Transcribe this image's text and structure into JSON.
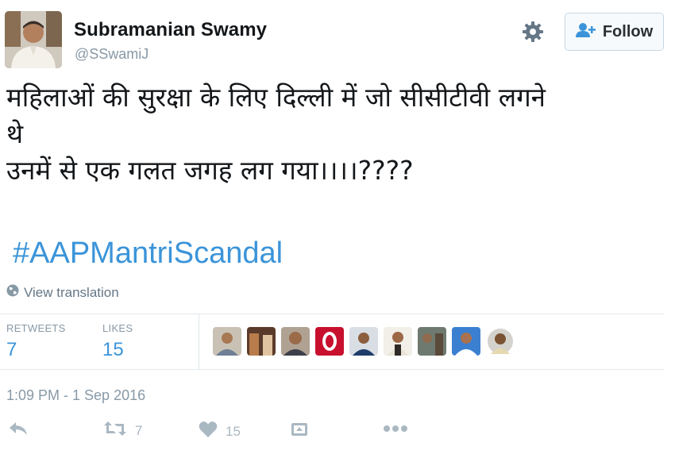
{
  "author": {
    "name": "Subramanian Swamy",
    "handle": "@SSwamiJ"
  },
  "header": {
    "follow_label": "Follow"
  },
  "tweet": {
    "lines": [
      "महिलाओं की सुरक्षा के लिए दिल्ली में जो सीसीटीवी लगने",
      "थे",
      "उनमें से एक गलत जगह लग गया।।।।????"
    ],
    "hashtag": "#AAPMantriScandal",
    "view_translation": "View translation"
  },
  "stats": {
    "retweets_label": "RETWEETS",
    "retweets_count": "7",
    "likes_label": "LIKES",
    "likes_count": "15"
  },
  "timestamp": "1:09 PM - 1 Sep 2016",
  "actions": {
    "retweet_count": "7",
    "like_count": "15"
  },
  "colors": {
    "accent": "#3b94d9",
    "muted": "#8899a6",
    "icon": "#aab8c2"
  },
  "icons": [
    "settings-gear-icon",
    "follow-person-plus-icon",
    "globe-icon",
    "reply-icon",
    "retweet-icon",
    "heart-icon",
    "share-icon",
    "more-icon"
  ]
}
